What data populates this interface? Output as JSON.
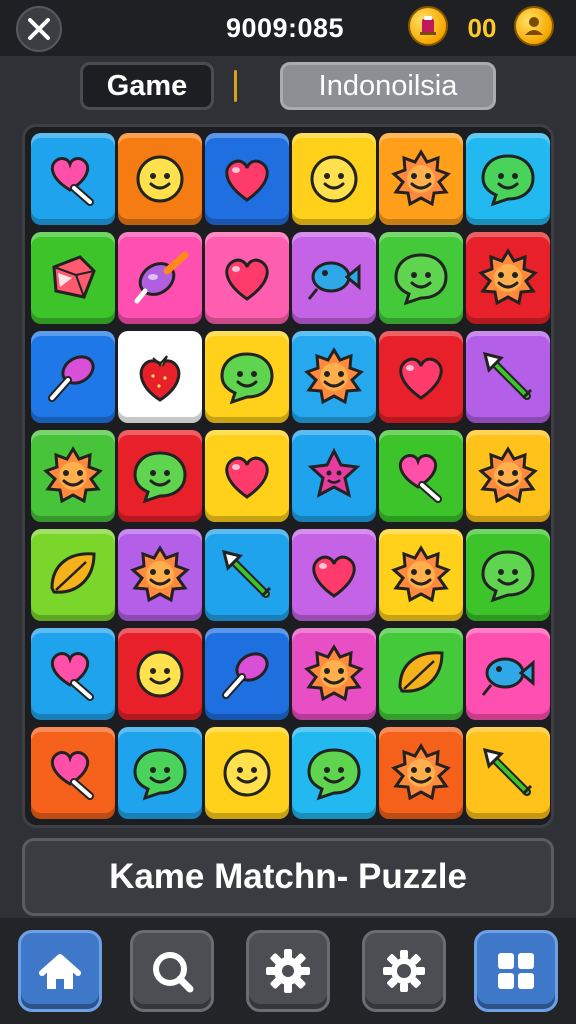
{
  "header": {
    "score": "9009:085",
    "coin_count": "00",
    "close_icon": "close-icon",
    "bonus_icon": "trophy-coin-icon",
    "avatar_icon": "player-coin-icon"
  },
  "tabs": {
    "game_label": "Game",
    "region_label": "Indonoilsia"
  },
  "board": {
    "rows": 7,
    "cols": 6,
    "tiles": [
      [
        {
          "color": "#1fa3ec",
          "icon": "heart-pin"
        },
        {
          "color": "#f57c12",
          "icon": "smiley"
        },
        {
          "color": "#1f6fe0",
          "icon": "heart"
        },
        {
          "color": "#ffd11a",
          "icon": "smiley"
        },
        {
          "color": "#ff9f1a",
          "icon": "sun"
        },
        {
          "color": "#22b8f0",
          "icon": "chat-bubble"
        }
      ],
      [
        {
          "color": "#3cc42a",
          "icon": "gem"
        },
        {
          "color": "#ff4fb0",
          "icon": "rocket"
        },
        {
          "color": "#ff5fae",
          "icon": "heart"
        },
        {
          "color": "#c463e6",
          "icon": "fish"
        },
        {
          "color": "#44c93a",
          "icon": "chat-smiley"
        },
        {
          "color": "#e8202a",
          "icon": "sun"
        }
      ],
      [
        {
          "color": "#1e78e8",
          "icon": "pin"
        },
        {
          "color": "#ffffff",
          "icon": "strawberry"
        },
        {
          "color": "#ffd11a",
          "icon": "chat-smiley"
        },
        {
          "color": "#25a8ee",
          "icon": "sun"
        },
        {
          "color": "#e8202a",
          "icon": "heart"
        },
        {
          "color": "#b45fe8",
          "icon": "arrow"
        }
      ],
      [
        {
          "color": "#47c43a",
          "icon": "sun"
        },
        {
          "color": "#e8202a",
          "icon": "chat-smiley"
        },
        {
          "color": "#ffd11a",
          "icon": "heart"
        },
        {
          "color": "#1fa3ec",
          "icon": "star-face"
        },
        {
          "color": "#3cc42a",
          "icon": "heart-pin"
        },
        {
          "color": "#ffc21a",
          "icon": "sun"
        }
      ],
      [
        {
          "color": "#7ad62a",
          "icon": "leaf"
        },
        {
          "color": "#b45fe8",
          "icon": "sun"
        },
        {
          "color": "#1fa3ec",
          "icon": "arrow"
        },
        {
          "color": "#c463e6",
          "icon": "heart"
        },
        {
          "color": "#ffd11a",
          "icon": "sun"
        },
        {
          "color": "#3cc42a",
          "icon": "chat-smiley"
        }
      ],
      [
        {
          "color": "#1fa3ec",
          "icon": "heart-pin"
        },
        {
          "color": "#e8202a",
          "icon": "smiley"
        },
        {
          "color": "#1e6fe0",
          "icon": "pin"
        },
        {
          "color": "#e84fc4",
          "icon": "sun"
        },
        {
          "color": "#44c93a",
          "icon": "leaf"
        },
        {
          "color": "#ff4fb0",
          "icon": "fish"
        }
      ],
      [
        {
          "color": "#f5601a",
          "icon": "heart-pin"
        },
        {
          "color": "#1fa3ec",
          "icon": "chat-bubble"
        },
        {
          "color": "#ffd11a",
          "icon": "smiley"
        },
        {
          "color": "#22b8f0",
          "icon": "chat-smiley"
        },
        {
          "color": "#f5601a",
          "icon": "sun"
        },
        {
          "color": "#ffc21a",
          "icon": "arrow"
        }
      ]
    ]
  },
  "banner": {
    "title": "Kame Matchn- Puzzle"
  },
  "nav": [
    {
      "icon": "home-icon",
      "style": "blue"
    },
    {
      "icon": "search-icon",
      "style": "grey"
    },
    {
      "icon": "gear-icon",
      "style": "grey"
    },
    {
      "icon": "settings-icon",
      "style": "grey"
    },
    {
      "icon": "grid-icon",
      "style": "blue"
    }
  ]
}
